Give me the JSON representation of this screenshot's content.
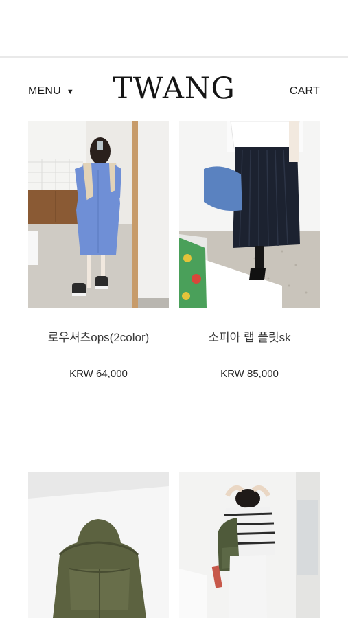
{
  "header": {
    "menu_label": "MENU",
    "menu_caret": "▼",
    "logo": "TWANG",
    "cart_label": "CART"
  },
  "products": [
    {
      "name": "로우셔츠ops(2color)",
      "price": "KRW 64,000",
      "photo_icon": "shirt-dress-photo"
    },
    {
      "name": "소피아 랩 플릿sk",
      "price": "KRW 85,000",
      "photo_icon": "pleated-skirt-photo"
    },
    {
      "name": "",
      "price": "",
      "photo_icon": "backpack-photo"
    },
    {
      "name": "",
      "price": "",
      "photo_icon": "backpack-model-photo"
    }
  ],
  "colors": {
    "background": "#ffffff",
    "divider": "#e9e9e9",
    "text": "#222222",
    "dress_blue": "#6f8fd6",
    "skirt_navy": "#1c2230",
    "bag_olive": "#5c6240"
  }
}
